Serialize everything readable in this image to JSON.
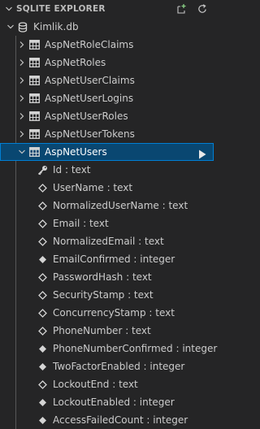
{
  "explorer": {
    "title": "SQLITE EXPLORER",
    "actions": [
      {
        "icon": "new-query-icon"
      },
      {
        "icon": "refresh-icon"
      }
    ]
  },
  "database": {
    "name": "Kimlik.db",
    "icon": "database-icon"
  },
  "tables": [
    {
      "name": "AspNetRoleClaims",
      "icon": "table-icon"
    },
    {
      "name": "AspNetRoles",
      "icon": "table-icon"
    },
    {
      "name": "AspNetUserClaims",
      "icon": "table-icon"
    },
    {
      "name": "AspNetUserLogins",
      "icon": "table-icon"
    },
    {
      "name": "AspNetUserRoles",
      "icon": "table-icon"
    },
    {
      "name": "AspNetUserTokens",
      "icon": "table-icon"
    }
  ],
  "selected_table": {
    "name": "AspNetUsers",
    "icon": "table-icon",
    "run_icon": "play-icon"
  },
  "columns": [
    {
      "label": "Id : text",
      "icon": "key-icon"
    },
    {
      "label": "UserName : text",
      "icon": "diamond-outline-icon"
    },
    {
      "label": "NormalizedUserName : text",
      "icon": "diamond-outline-icon"
    },
    {
      "label": "Email : text",
      "icon": "diamond-outline-icon"
    },
    {
      "label": "NormalizedEmail : text",
      "icon": "diamond-outline-icon"
    },
    {
      "label": "EmailConfirmed : integer",
      "icon": "diamond-filled-icon"
    },
    {
      "label": "PasswordHash : text",
      "icon": "diamond-outline-icon"
    },
    {
      "label": "SecurityStamp : text",
      "icon": "diamond-outline-icon"
    },
    {
      "label": "ConcurrencyStamp : text",
      "icon": "diamond-outline-icon"
    },
    {
      "label": "PhoneNumber : text",
      "icon": "diamond-outline-icon"
    },
    {
      "label": "PhoneNumberConfirmed : integer",
      "icon": "diamond-filled-icon"
    },
    {
      "label": "TwoFactorEnabled : integer",
      "icon": "diamond-filled-icon"
    },
    {
      "label": "LockoutEnd : text",
      "icon": "diamond-outline-icon"
    },
    {
      "label": "LockoutEnabled : integer",
      "icon": "diamond-filled-icon"
    },
    {
      "label": "AccessFailedCount : integer",
      "icon": "diamond-filled-icon"
    }
  ],
  "colors": {
    "background": "#252526",
    "selection": "#094771",
    "selection_border": "#007fd4",
    "text": "#cccccc",
    "new_query_accent": "#89d185"
  }
}
